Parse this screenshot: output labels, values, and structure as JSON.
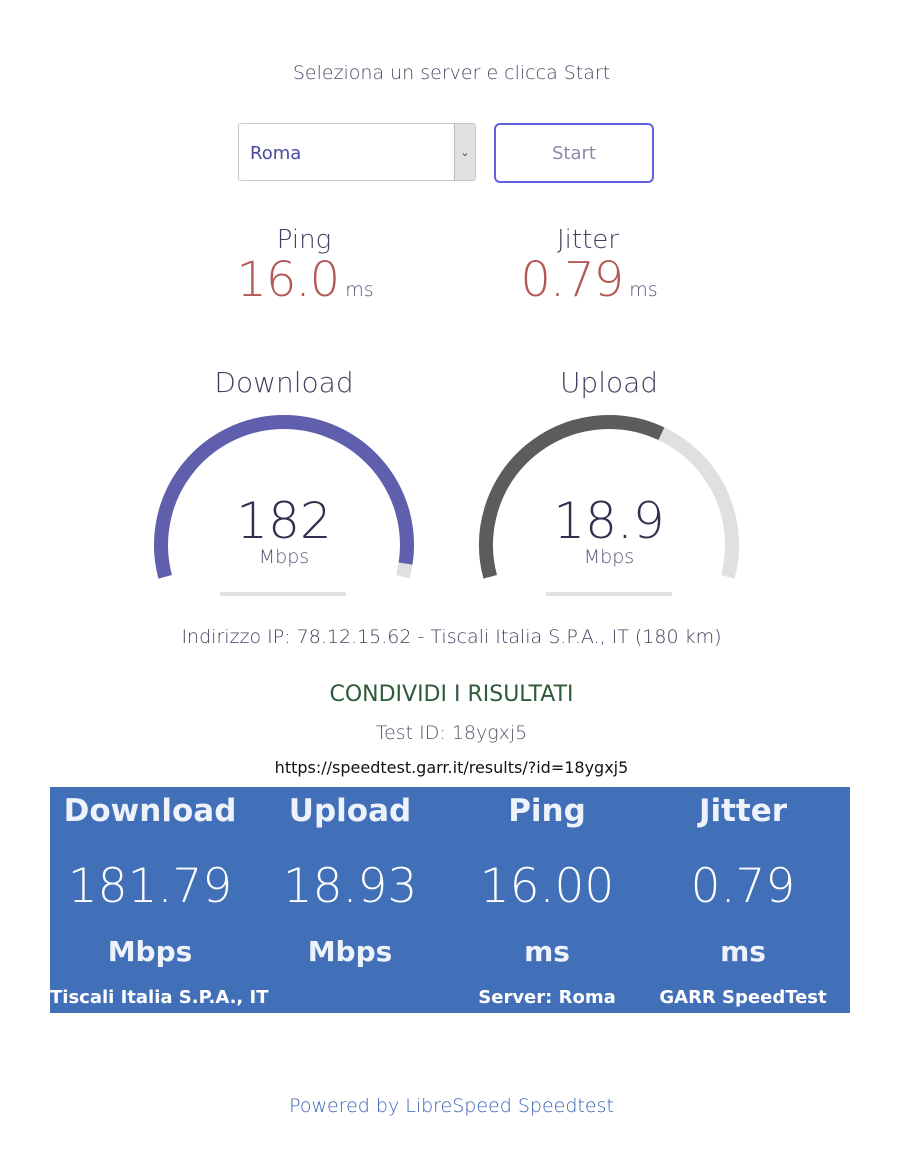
{
  "header": {
    "instruction": "Seleziona un server e clicca Start"
  },
  "controls": {
    "server_selected": "Roma",
    "start_label": "Start"
  },
  "ping": {
    "label": "Ping",
    "value": "16.0",
    "unit": "ms"
  },
  "jitter": {
    "label": "Jitter",
    "value": "0.79",
    "unit": "ms"
  },
  "download": {
    "label": "Download",
    "value": "182",
    "unit": "Mbps",
    "gauge_fraction": 0.97
  },
  "upload": {
    "label": "Upload",
    "value": "18.9",
    "unit": "Mbps",
    "gauge_fraction": 0.62
  },
  "ip_info": "Indirizzo IP: 78.12.15.62 - Tiscali Italia S.P.A., IT (180 km)",
  "share": {
    "title": "CONDIVIDI I RISULTATI",
    "test_id": "Test ID: 18ygxj5",
    "url": "https://speedtest.garr.it/results/?id=18ygxj5"
  },
  "result_image": {
    "columns": [
      {
        "head": "Download",
        "value": "181.79",
        "unit": "Mbps",
        "foot": "Tiscali Italia S.P.A., IT"
      },
      {
        "head": "Upload",
        "value": "18.93",
        "unit": "Mbps",
        "foot": ""
      },
      {
        "head": "Ping",
        "value": "16.00",
        "unit": "ms",
        "foot": "Server: Roma"
      },
      {
        "head": "Jitter",
        "value": "0.79",
        "unit": "ms",
        "foot": "GARR SpeedTest"
      }
    ]
  },
  "footer": {
    "powered_by": "Powered by LibreSpeed Speedtest"
  },
  "colors": {
    "download_arc": "#5f5fad",
    "upload_arc": "#5c5c5c",
    "gauge_track": "#e0e0e0",
    "result_bg": "#416fb8",
    "metric_value": "#b25856",
    "share_title": "#2c5a3a",
    "start_border": "#6060e0"
  }
}
